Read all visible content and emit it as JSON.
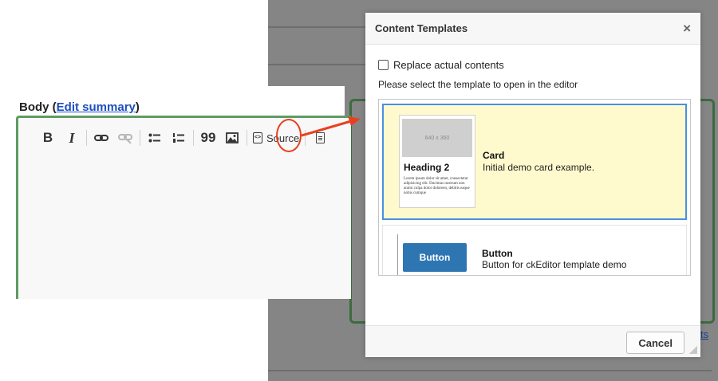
{
  "editor": {
    "body_label": "Body (",
    "edit_summary_link": "Edit summary",
    "body_label_close": ")",
    "toolbar": {
      "bold": "B",
      "italic": "I",
      "link_icon": "link-icon",
      "unlink_icon": "unlink-icon",
      "bulleted_list_icon": "bulleted-list-icon",
      "numbered_list_icon": "numbered-list-icon",
      "blockquote": "99",
      "image_icon": "image-icon",
      "source_label": "Source",
      "templates_icon": "document-icon"
    }
  },
  "backdrop": {
    "link_fragment": "ts"
  },
  "dialog": {
    "title": "Content Templates",
    "close_glyph": "×",
    "replace_label": "Replace actual contents",
    "replace_checked": false,
    "hint": "Please select the template to open in the editor",
    "templates": [
      {
        "name": "Card",
        "description": "Initial demo card example.",
        "thumb_image_label": "640 x 360",
        "thumb_heading": "Heading 2",
        "thumb_text": "Lorem ipsum dolor sit amet, consectetur adipisicing elit. Ducimus nostrum non animi culpa dolor doloreen, debitis eaque nobis cumque",
        "selected": true
      },
      {
        "name": "Button",
        "description": "Button for ckEditor template demo",
        "thumb_button_label": "Button",
        "selected": false
      }
    ],
    "cancel_label": "Cancel"
  },
  "colors": {
    "highlight": "#e8401c",
    "selection_border": "#4a90e2",
    "selection_bg": "#fffacd",
    "editor_border": "#5f9c62",
    "button_blue": "#2e76b2"
  }
}
